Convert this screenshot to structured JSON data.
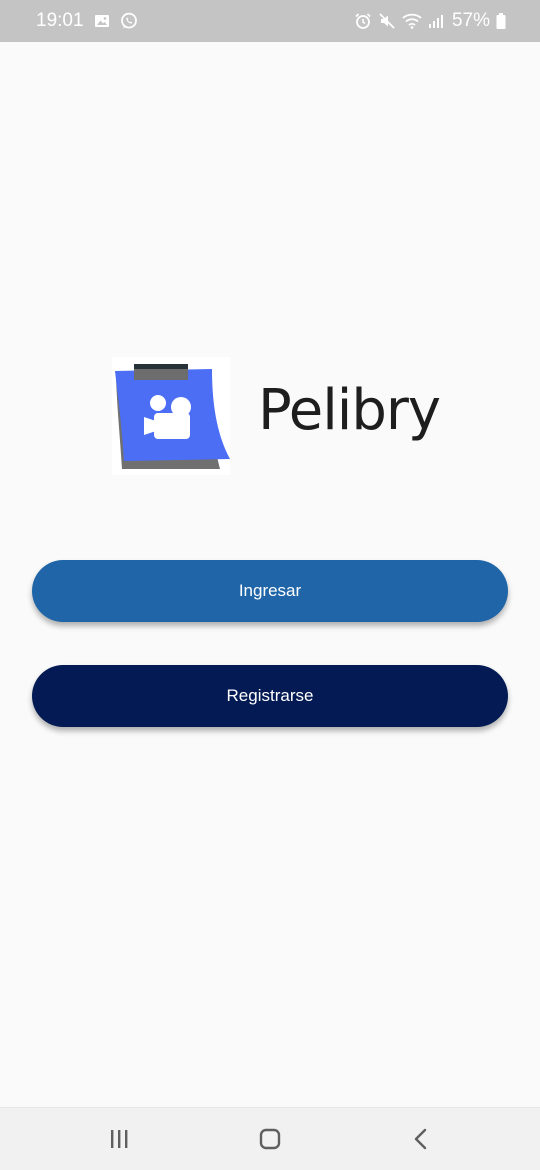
{
  "status_bar": {
    "time": "19:01",
    "battery_percent": "57%",
    "icons_left": [
      "gallery-icon",
      "whatsapp-icon"
    ],
    "icons_right": [
      "alarm-icon",
      "mute-icon",
      "wifi-icon",
      "signal-icon",
      "battery-icon"
    ]
  },
  "app": {
    "name": "Pelibry",
    "logo_icon": "movie-camera-note-icon"
  },
  "buttons": {
    "login_label": "Ingresar",
    "register_label": "Registrarse"
  },
  "nav_bar": {
    "icons": [
      "recent-apps-icon",
      "home-icon",
      "back-icon"
    ]
  },
  "colors": {
    "status_bar_bg": "#c4c4c4",
    "background": "#fafafa",
    "login_button": "#1f65a8",
    "register_button": "#031a54",
    "logo_blue": "#4b6ef5",
    "logo_gray": "#707070",
    "title_text": "#1e1e1e"
  }
}
